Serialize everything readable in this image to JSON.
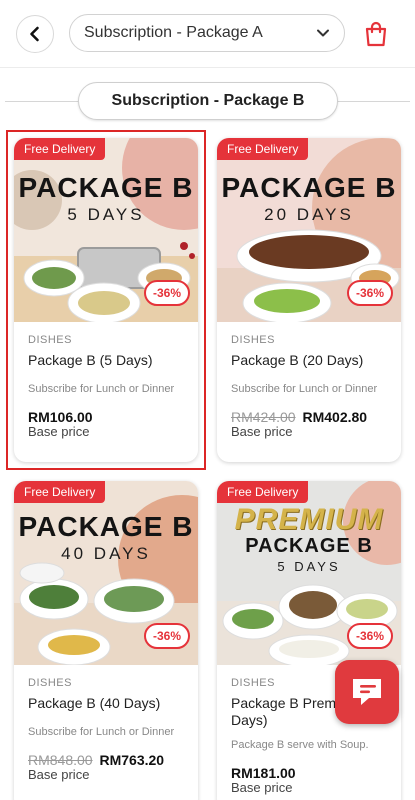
{
  "header": {
    "back_icon": "chevron-left-icon",
    "package_select": {
      "selected": "Subscription - Package A"
    },
    "cart_icon": "shopping-bag-icon"
  },
  "section": {
    "title": "Subscription - Package B"
  },
  "colors": {
    "accent": "#e5333a",
    "selected_border": "#dc2626"
  },
  "products": [
    {
      "badge": "Free Delivery",
      "image_title": "PACKAGE B",
      "image_subtitle": "5 DAYS",
      "discount": "-36%",
      "category": "DISHES",
      "name": "Package B (5 Days)",
      "description": "Subscribe for Lunch or Dinner",
      "old_price": "",
      "price": "RM106.00",
      "price_note": "Base price",
      "selected": true
    },
    {
      "badge": "Free Delivery",
      "image_title": "PACKAGE B",
      "image_subtitle": "20 DAYS",
      "discount": "-36%",
      "category": "DISHES",
      "name": "Package B (20 Days)",
      "description": "Subscribe for Lunch or Dinner",
      "old_price": "RM424.00",
      "price": "RM402.80",
      "price_note": "Base price"
    },
    {
      "badge": "Free Delivery",
      "image_title": "PACKAGE B",
      "image_subtitle": "40 DAYS",
      "discount": "-36%",
      "category": "DISHES",
      "name": "Package B (40 Days)",
      "description": "Subscribe for Lunch or Dinner",
      "old_price": "RM848.00",
      "price": "RM763.20",
      "price_note": "Base price"
    },
    {
      "badge": "Free Delivery",
      "image_premium": "PREMIUM",
      "image_title": "PACKAGE B",
      "image_subtitle": "5 DAYS",
      "discount": "-36%",
      "category": "DISHES",
      "name": "Package B Premium (5 Days)",
      "description": "Package B serve with Soup.",
      "old_price": "",
      "price": "RM181.00",
      "price_note": "Base price"
    }
  ],
  "chat_fab": {
    "icon": "chat-bubble-icon"
  }
}
